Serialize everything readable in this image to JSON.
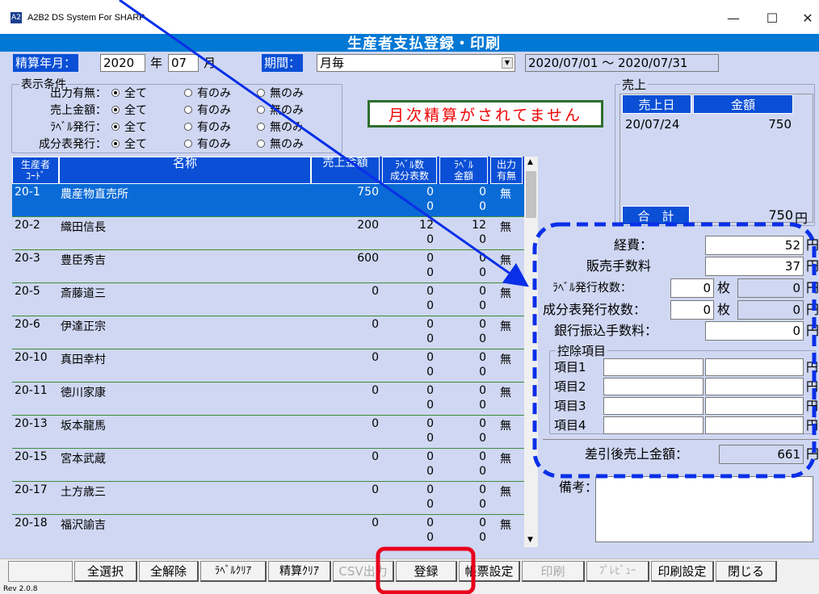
{
  "window": {
    "title": "A2B2 DS System For SHARP",
    "minimize": "—",
    "maximize": "☐",
    "close": "✕"
  },
  "header": {
    "title": "生産者支払登録・印刷"
  },
  "period": {
    "ym_label": "精算年月：",
    "year": "2020",
    "year_unit": "年",
    "month": "07",
    "month_unit": "月",
    "period_label": "期間：",
    "period_value": "月毎",
    "date_range": "2020/07/01 〜 2020/07/31"
  },
  "conditions": {
    "title": "表示条件",
    "rows": [
      {
        "label": "出力有無：",
        "opts": [
          "全て",
          "有のみ",
          "無のみ"
        ]
      },
      {
        "label": "売上金額：",
        "opts": [
          "全て",
          "有のみ",
          "無のみ"
        ]
      },
      {
        "label": "ﾗﾍﾞﾙ発行：",
        "opts": [
          "全て",
          "有のみ",
          "無のみ"
        ]
      },
      {
        "label": "成分表発行：",
        "opts": [
          "全て",
          "有のみ",
          "無のみ"
        ]
      }
    ]
  },
  "alert": "月次精算がされてません",
  "table": {
    "headers": {
      "code": "生産者\nｺｰﾄﾞ",
      "name": "名称",
      "sales": "売上金額",
      "label_count": "ﾗﾍﾞﾙ数\n成分表数",
      "label_amount": "ﾗﾍﾞﾙ\n金額",
      "output": "出力\n有無"
    },
    "rows": [
      {
        "code": "20-1",
        "name": "農産物直売所",
        "sales": "750",
        "labels": "0",
        "comps": "0",
        "lamt": "0",
        "lamt2": "0",
        "out": "無"
      },
      {
        "code": "20-2",
        "name": "織田信長",
        "sales": "200",
        "labels": "12",
        "comps": "0",
        "lamt": "12",
        "lamt2": "0",
        "out": "無"
      },
      {
        "code": "20-3",
        "name": "豊臣秀吉",
        "sales": "600",
        "labels": "0",
        "comps": "0",
        "lamt": "0",
        "lamt2": "0",
        "out": "無"
      },
      {
        "code": "20-5",
        "name": "斎藤道三",
        "sales": "0",
        "labels": "0",
        "comps": "0",
        "lamt": "0",
        "lamt2": "0",
        "out": "無"
      },
      {
        "code": "20-6",
        "name": "伊達正宗",
        "sales": "0",
        "labels": "0",
        "comps": "0",
        "lamt": "0",
        "lamt2": "0",
        "out": "無"
      },
      {
        "code": "20-10",
        "name": "真田幸村",
        "sales": "0",
        "labels": "0",
        "comps": "0",
        "lamt": "0",
        "lamt2": "0",
        "out": "無"
      },
      {
        "code": "20-11",
        "name": "徳川家康",
        "sales": "0",
        "labels": "0",
        "comps": "0",
        "lamt": "0",
        "lamt2": "0",
        "out": "無"
      },
      {
        "code": "20-13",
        "name": "坂本龍馬",
        "sales": "0",
        "labels": "0",
        "comps": "0",
        "lamt": "0",
        "lamt2": "0",
        "out": "無"
      },
      {
        "code": "20-15",
        "name": "宮本武蔵",
        "sales": "0",
        "labels": "0",
        "comps": "0",
        "lamt": "0",
        "lamt2": "0",
        "out": "無"
      },
      {
        "code": "20-17",
        "name": "土方歳三",
        "sales": "0",
        "labels": "0",
        "comps": "0",
        "lamt": "0",
        "lamt2": "0",
        "out": "無"
      },
      {
        "code": "20-18",
        "name": "福沢諭吉",
        "sales": "0",
        "labels": "0",
        "comps": "0",
        "lamt": "0",
        "lamt2": "0",
        "out": "無"
      }
    ]
  },
  "sales": {
    "title": "売上",
    "col_date": "売上日",
    "col_amount": "金額",
    "rows": [
      {
        "date": "20/07/24",
        "amount": "750"
      }
    ],
    "total_label": "合　計",
    "total": "750",
    "total_unit": "円"
  },
  "settlement": {
    "expense_label": "経費：",
    "expense": "52",
    "yen": "円",
    "fee_label": "販売手数料",
    "fee": "37",
    "label_issue": "ﾗﾍﾞﾙ発行枚数：",
    "label_issue_count": "0",
    "label_issue_unit": "枚",
    "label_issue_amt": "0",
    "comp_issue": "成分表発行枚数：",
    "comp_issue_count": "0",
    "comp_issue_unit": "枚",
    "comp_issue_amt": "0",
    "bank_fee_label": "銀行振込手数料：",
    "bank_fee": "0",
    "deduction_title": "控除項目",
    "items": [
      "項目1",
      "項目2",
      "項目3",
      "項目4"
    ],
    "net_label": "差引後売上金額：",
    "net": "661"
  },
  "remarks": {
    "label": "備考："
  },
  "toolbar": {
    "select_all": "全選択",
    "deselect_all": "全解除",
    "label_clear": "ﾗﾍﾞﾙｸﾘｱ",
    "settle_clear": "精算ｸﾘｱ",
    "csv": "CSV出力",
    "register": "登録",
    "form_settings": "帳票設定",
    "print": "印刷",
    "preview": "ﾌﾟﾚﾋﾞｭｰ",
    "print_settings": "印刷設定",
    "close": "閉じる"
  },
  "status": {
    "version": "Rev 2.0.8"
  },
  "colors": {
    "accent": "#0a4fd6",
    "header": "#0078d4",
    "annotation_blue": "#0a2fe8",
    "annotation_red": "#e8001c"
  }
}
